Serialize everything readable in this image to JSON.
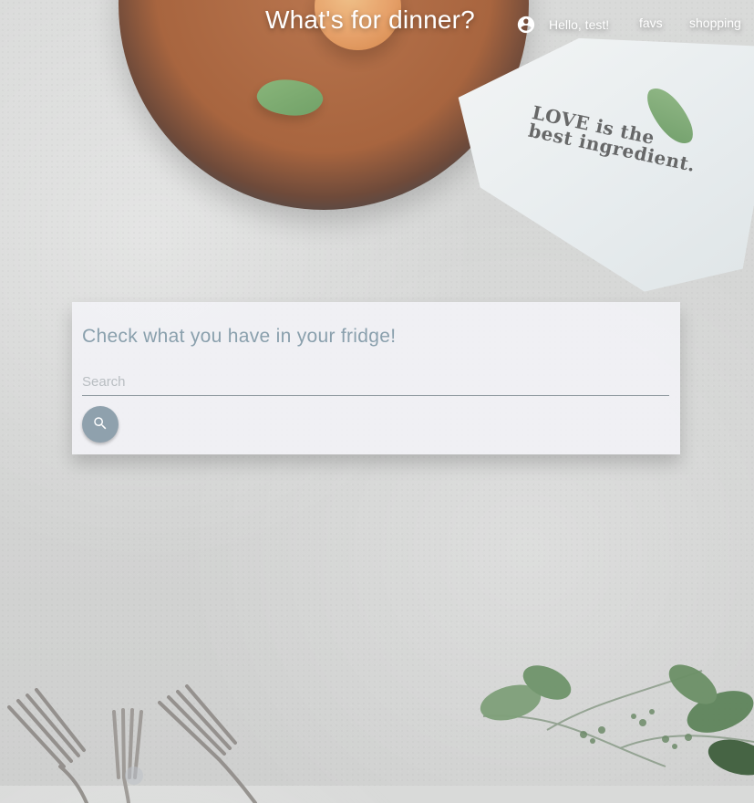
{
  "header": {
    "brand": "What's for dinner?",
    "user_greeting": "Hello, test!",
    "nav": [
      {
        "label": "favs"
      },
      {
        "label": "shopping"
      }
    ]
  },
  "background": {
    "towel_text_line1": "LOVE is the",
    "towel_text_line2": "best ingredient."
  },
  "search_card": {
    "title": "Check what you have in your fridge!",
    "input_value": "",
    "input_placeholder": "Search",
    "button_icon": "search-icon"
  },
  "icons": {
    "user": "account-circle-icon",
    "search": "search-icon"
  },
  "colors": {
    "header_text": "#ffffff",
    "card_title": "#8aa0ad",
    "search_button": "#8fa1ad",
    "input_underline": "#8b969c",
    "placeholder": "#b9bec2",
    "card_background": "rgba(242,242,247,0.88)"
  }
}
